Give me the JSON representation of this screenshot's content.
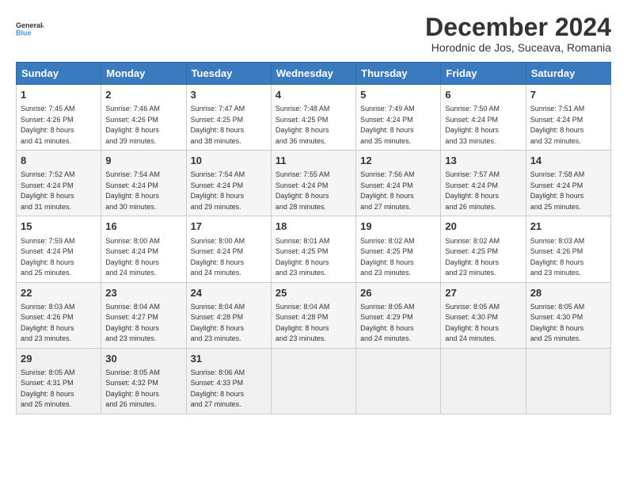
{
  "header": {
    "logo_line1": "General",
    "logo_line2": "Blue",
    "month": "December 2024",
    "location": "Horodnic de Jos, Suceava, Romania"
  },
  "days_of_week": [
    "Sunday",
    "Monday",
    "Tuesday",
    "Wednesday",
    "Thursday",
    "Friday",
    "Saturday"
  ],
  "weeks": [
    [
      {
        "day": "1",
        "info": "Sunrise: 7:45 AM\nSunset: 4:26 PM\nDaylight: 8 hours\nand 41 minutes."
      },
      {
        "day": "2",
        "info": "Sunrise: 7:46 AM\nSunset: 4:26 PM\nDaylight: 8 hours\nand 39 minutes."
      },
      {
        "day": "3",
        "info": "Sunrise: 7:47 AM\nSunset: 4:25 PM\nDaylight: 8 hours\nand 38 minutes."
      },
      {
        "day": "4",
        "info": "Sunrise: 7:48 AM\nSunset: 4:25 PM\nDaylight: 8 hours\nand 36 minutes."
      },
      {
        "day": "5",
        "info": "Sunrise: 7:49 AM\nSunset: 4:24 PM\nDaylight: 8 hours\nand 35 minutes."
      },
      {
        "day": "6",
        "info": "Sunrise: 7:50 AM\nSunset: 4:24 PM\nDaylight: 8 hours\nand 33 minutes."
      },
      {
        "day": "7",
        "info": "Sunrise: 7:51 AM\nSunset: 4:24 PM\nDaylight: 8 hours\nand 32 minutes."
      }
    ],
    [
      {
        "day": "8",
        "info": "Sunrise: 7:52 AM\nSunset: 4:24 PM\nDaylight: 8 hours\nand 31 minutes."
      },
      {
        "day": "9",
        "info": "Sunrise: 7:54 AM\nSunset: 4:24 PM\nDaylight: 8 hours\nand 30 minutes."
      },
      {
        "day": "10",
        "info": "Sunrise: 7:54 AM\nSunset: 4:24 PM\nDaylight: 8 hours\nand 29 minutes."
      },
      {
        "day": "11",
        "info": "Sunrise: 7:55 AM\nSunset: 4:24 PM\nDaylight: 8 hours\nand 28 minutes."
      },
      {
        "day": "12",
        "info": "Sunrise: 7:56 AM\nSunset: 4:24 PM\nDaylight: 8 hours\nand 27 minutes."
      },
      {
        "day": "13",
        "info": "Sunrise: 7:57 AM\nSunset: 4:24 PM\nDaylight: 8 hours\nand 26 minutes."
      },
      {
        "day": "14",
        "info": "Sunrise: 7:58 AM\nSunset: 4:24 PM\nDaylight: 8 hours\nand 25 minutes."
      }
    ],
    [
      {
        "day": "15",
        "info": "Sunrise: 7:59 AM\nSunset: 4:24 PM\nDaylight: 8 hours\nand 25 minutes."
      },
      {
        "day": "16",
        "info": "Sunrise: 8:00 AM\nSunset: 4:24 PM\nDaylight: 8 hours\nand 24 minutes."
      },
      {
        "day": "17",
        "info": "Sunrise: 8:00 AM\nSunset: 4:24 PM\nDaylight: 8 hours\nand 24 minutes."
      },
      {
        "day": "18",
        "info": "Sunrise: 8:01 AM\nSunset: 4:25 PM\nDaylight: 8 hours\nand 23 minutes."
      },
      {
        "day": "19",
        "info": "Sunrise: 8:02 AM\nSunset: 4:25 PM\nDaylight: 8 hours\nand 23 minutes."
      },
      {
        "day": "20",
        "info": "Sunrise: 8:02 AM\nSunset: 4:25 PM\nDaylight: 8 hours\nand 23 minutes."
      },
      {
        "day": "21",
        "info": "Sunrise: 8:03 AM\nSunset: 4:26 PM\nDaylight: 8 hours\nand 23 minutes."
      }
    ],
    [
      {
        "day": "22",
        "info": "Sunrise: 8:03 AM\nSunset: 4:26 PM\nDaylight: 8 hours\nand 23 minutes."
      },
      {
        "day": "23",
        "info": "Sunrise: 8:04 AM\nSunset: 4:27 PM\nDaylight: 8 hours\nand 23 minutes."
      },
      {
        "day": "24",
        "info": "Sunrise: 8:04 AM\nSunset: 4:28 PM\nDaylight: 8 hours\nand 23 minutes."
      },
      {
        "day": "25",
        "info": "Sunrise: 8:04 AM\nSunset: 4:28 PM\nDaylight: 8 hours\nand 23 minutes."
      },
      {
        "day": "26",
        "info": "Sunrise: 8:05 AM\nSunset: 4:29 PM\nDaylight: 8 hours\nand 24 minutes."
      },
      {
        "day": "27",
        "info": "Sunrise: 8:05 AM\nSunset: 4:30 PM\nDaylight: 8 hours\nand 24 minutes."
      },
      {
        "day": "28",
        "info": "Sunrise: 8:05 AM\nSunset: 4:30 PM\nDaylight: 8 hours\nand 25 minutes."
      }
    ],
    [
      {
        "day": "29",
        "info": "Sunrise: 8:05 AM\nSunset: 4:31 PM\nDaylight: 8 hours\nand 25 minutes."
      },
      {
        "day": "30",
        "info": "Sunrise: 8:05 AM\nSunset: 4:32 PM\nDaylight: 8 hours\nand 26 minutes."
      },
      {
        "day": "31",
        "info": "Sunrise: 8:06 AM\nSunset: 4:33 PM\nDaylight: 8 hours\nand 27 minutes."
      },
      {
        "day": "",
        "info": ""
      },
      {
        "day": "",
        "info": ""
      },
      {
        "day": "",
        "info": ""
      },
      {
        "day": "",
        "info": ""
      }
    ]
  ]
}
